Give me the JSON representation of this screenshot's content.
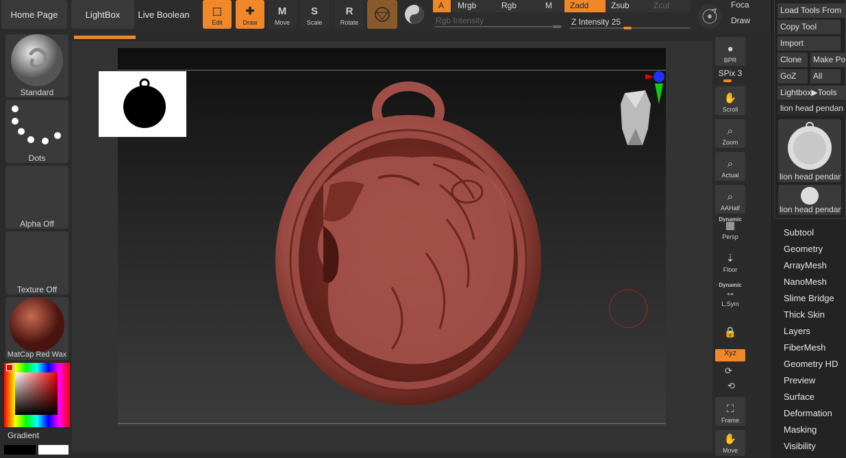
{
  "topbar": {
    "home_page": "Home Page",
    "lightbox": "LightBox",
    "live_boolean": "Live Boolean",
    "tools": [
      {
        "label": "Edit",
        "glyph": "⬚",
        "active": true
      },
      {
        "label": "Draw",
        "glyph": "✚",
        "active": true
      },
      {
        "label": "Move",
        "glyph": "M",
        "active": false
      },
      {
        "label": "Scale",
        "glyph": "S",
        "active": false
      },
      {
        "label": "Rotate",
        "glyph": "R",
        "active": false
      }
    ],
    "modes": {
      "a": "A",
      "mrgb": "Mrgb",
      "rgb": "Rgb",
      "m": "M",
      "zadd": "Zadd",
      "zsub": "Zsub",
      "zcut": "Zcut"
    },
    "rgb_intensity": "Rgb Intensity",
    "z_intensity": "Z Intensity 25",
    "focal": "Foca",
    "draw_size": "Draw"
  },
  "left_panel": {
    "brush": "Standard",
    "stroke": "Dots",
    "alpha": "Alpha Off",
    "texture": "Texture Off",
    "material": "MatCap Red Wax",
    "gradient": "Gradient"
  },
  "shelf": {
    "bpr": "BPR",
    "spix": "SPix 3",
    "scroll": "Scroll",
    "zoom": "Zoom",
    "actual": "Actual",
    "aahalf": "AAHalf",
    "dynamic1": "Dynamic",
    "persp": "Persp",
    "floor": "Floor",
    "dynamic2": "Dynamic",
    "lsym": "L.Sym",
    "xyz": "Xyz",
    "frame": "Frame",
    "move": "Move"
  },
  "tool_panel": {
    "load_tools": "Load Tools From",
    "copy_tool": "Copy Tool",
    "import": "Import",
    "clone": "Clone",
    "make_polymesh": "Make Po",
    "goz": "GoZ",
    "all": "All",
    "lightbox_tools": "Lightbox▶Tools",
    "current_tool": "lion head pendan",
    "thumb1": "lion head pendan",
    "thumb2": "lion head pendan",
    "menu": [
      "Subtool",
      "Geometry",
      "ArrayMesh",
      "NanoMesh",
      "Slime Bridge",
      "Thick Skin",
      "Layers",
      "FiberMesh",
      "Geometry HD",
      "Preview",
      "Surface",
      "Deformation",
      "Masking",
      "Visibility"
    ]
  },
  "colors": {
    "accent": "#f0882a",
    "wax": "#a8554e"
  }
}
